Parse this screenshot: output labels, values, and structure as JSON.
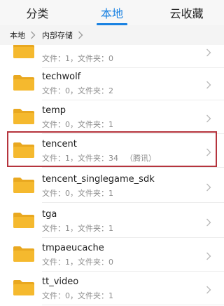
{
  "tabs": [
    {
      "label": "分类",
      "active": false
    },
    {
      "label": "本地",
      "active": true
    },
    {
      "label": "云收藏",
      "active": false
    }
  ],
  "breadcrumb": {
    "items": [
      "本地",
      "内部存储"
    ]
  },
  "colors": {
    "accent": "#1a82e2",
    "folder": "#f5b92e",
    "highlight": "#b5343d"
  },
  "files": [
    {
      "name": "",
      "meta": "文件：1，文件夹：0"
    },
    {
      "name": "techwolf",
      "meta": "文件：0，文件夹：2"
    },
    {
      "name": "temp",
      "meta": "文件：0，文件夹：1"
    },
    {
      "name": "tencent",
      "meta": "文件：1，文件夹：34",
      "tag": "（腾讯）",
      "selected": true
    },
    {
      "name": "tencent_singlegame_sdk",
      "meta": "文件：0，文件夹：1"
    },
    {
      "name": "tga",
      "meta": "文件：1，文件夹：1"
    },
    {
      "name": "tmpaeucache",
      "meta": "文件：1，文件夹：0"
    },
    {
      "name": "tt_video",
      "meta": "文件：0，文件夹：1"
    }
  ]
}
